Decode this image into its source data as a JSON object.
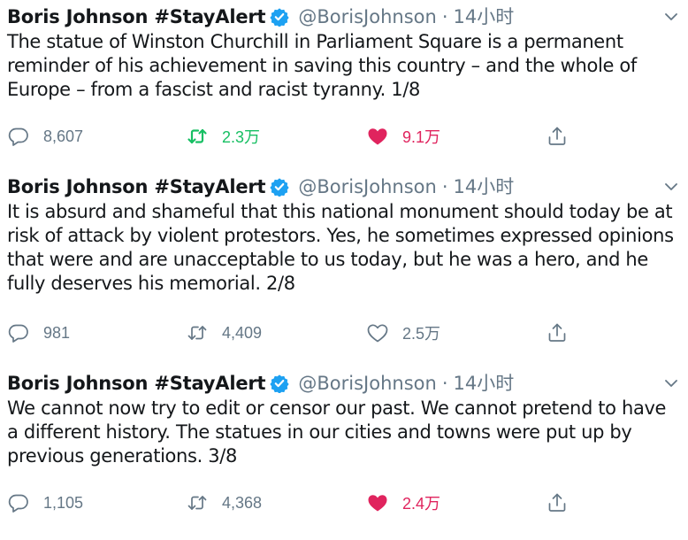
{
  "tweets": [
    {
      "author": "Boris Johnson #StayAlert",
      "handle": "@BorisJohnson",
      "separator": "·",
      "time": "14小时",
      "text": "The statue of Winston Churchill in Parliament Square is a permanent reminder of his achievement in saving this country – and the whole of Europe – from a fascist and racist tyranny. 1/8",
      "replies": "8,607",
      "retweets": "2.3万",
      "likes": "9.1万",
      "retweeted": true,
      "liked": true
    },
    {
      "author": "Boris Johnson #StayAlert",
      "handle": "@BorisJohnson",
      "separator": "·",
      "time": "14小时",
      "text": "It is absurd and shameful that this national monument should today be at risk of attack by violent protestors. Yes, he sometimes expressed opinions that were and are unacceptable to us today, but he was a hero, and he fully deserves his memorial. 2/8",
      "replies": "981",
      "retweets": "4,409",
      "likes": "2.5万",
      "retweeted": false,
      "liked": false
    },
    {
      "author": "Boris Johnson #StayAlert",
      "handle": "@BorisJohnson",
      "separator": "·",
      "time": "14小时",
      "text": "We cannot now try to edit or censor our past. We cannot pretend to have a different history. The statues in our cities and towns were put up by previous generations. 3/8",
      "replies": "1,105",
      "retweets": "4,368",
      "likes": "2.4万",
      "retweeted": false,
      "liked": true
    }
  ],
  "icons": {
    "verified": "verified-badge-icon",
    "caret": "chevron-down-icon",
    "reply": "reply-icon",
    "retweet": "retweet-icon",
    "like": "heart-icon",
    "share": "share-icon"
  },
  "colors": {
    "verified": "#1da1f2",
    "retweet_active": "#17bf63",
    "like_active": "#e0245e",
    "muted": "#657786",
    "text": "#14171a"
  }
}
